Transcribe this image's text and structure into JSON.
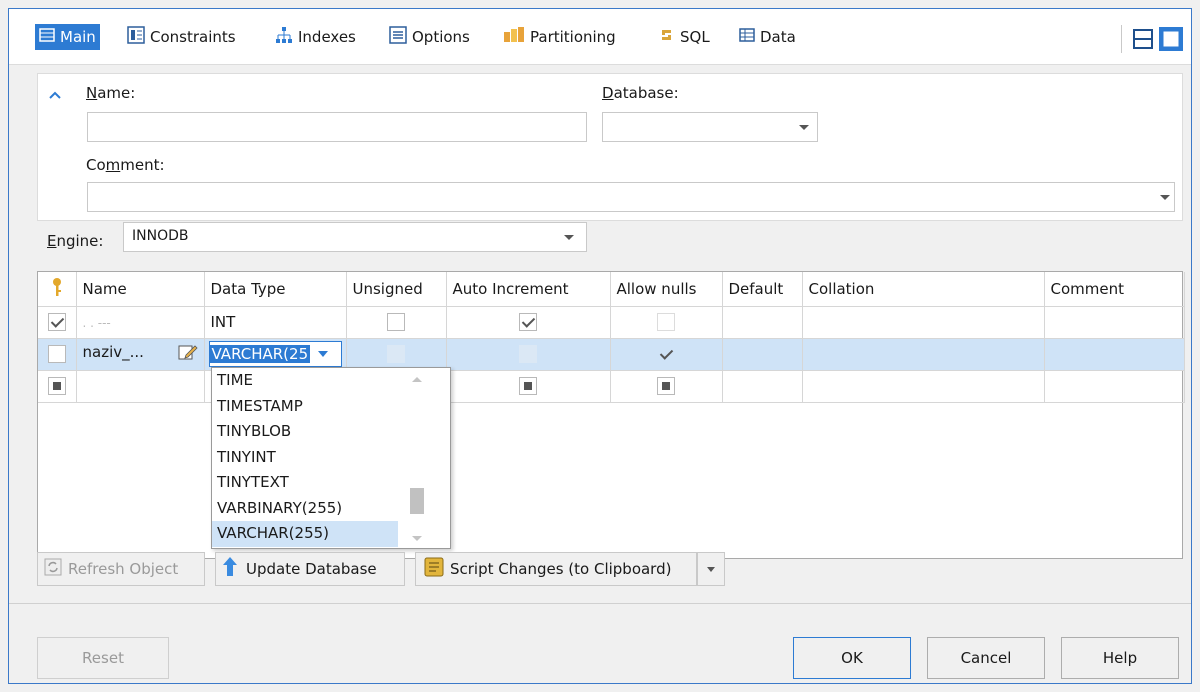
{
  "tabs": [
    {
      "label": "Main",
      "icon": "table-icon",
      "active": true
    },
    {
      "label": "Constraints",
      "icon": "constraints-icon"
    },
    {
      "label": "Indexes",
      "icon": "indexes-icon"
    },
    {
      "label": "Options",
      "icon": "options-icon"
    },
    {
      "label": "Partitioning",
      "icon": "partitioning-icon"
    },
    {
      "label": "SQL",
      "icon": "sql-icon"
    },
    {
      "label": "Data",
      "icon": "data-icon"
    }
  ],
  "form": {
    "name_label_u": "N",
    "name_label_rest": "ame:",
    "database_label_u": "D",
    "database_label_rest": "atabase:",
    "comment_label_pre": "Co",
    "comment_label_u": "m",
    "comment_label_rest": "ment:",
    "engine_label_u": "E",
    "engine_label_rest": "ngine:",
    "engine_value": "INNODB"
  },
  "grid": {
    "columns": [
      "Name",
      "Data Type",
      "Unsigned",
      "Auto Increment",
      "Allow nulls",
      "Default",
      "Collation",
      "Comment"
    ],
    "rows": [
      {
        "name": "",
        "data_type": "INT",
        "unsigned": false,
        "auto_increment": true,
        "allow_nulls": false
      },
      {
        "name": "naziv_...",
        "data_type": "VARCHAR(25",
        "unsigned": false,
        "auto_increment": false,
        "allow_nulls": true
      }
    ]
  },
  "datatype_dropdown": {
    "options": [
      "TIME",
      "TIMESTAMP",
      "TINYBLOB",
      "TINYINT",
      "TINYTEXT",
      "VARBINARY(255)",
      "VARCHAR(255)"
    ],
    "selected": "VARCHAR(255)"
  },
  "toolbar": {
    "refresh_label": "Refresh Object",
    "update_label": "Update Database",
    "script_label": "Script Changes (to Clipboard)"
  },
  "buttons": {
    "reset": "Reset",
    "ok": "OK",
    "cancel": "Cancel",
    "help": "Help"
  },
  "colors": {
    "accent": "#2d7bd3",
    "selection": "#cfe3f7"
  }
}
